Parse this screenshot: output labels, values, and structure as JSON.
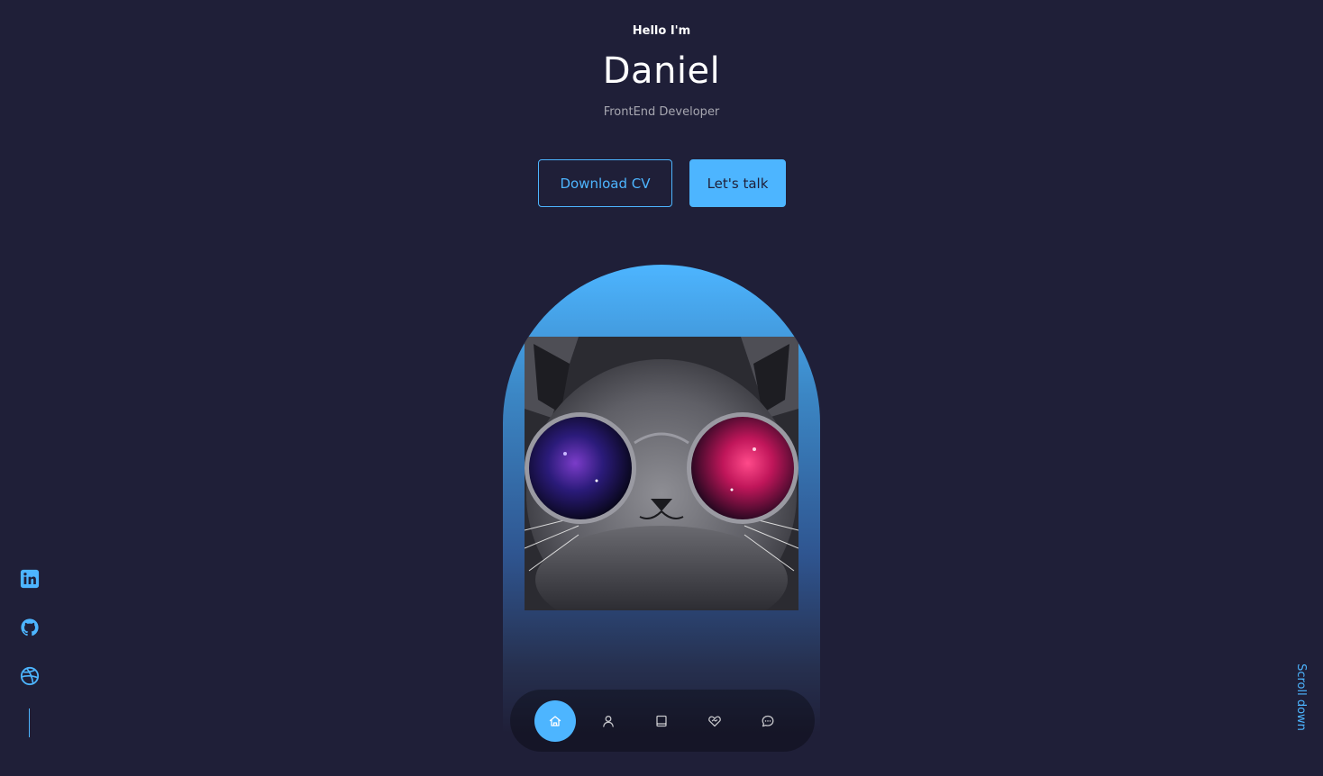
{
  "header": {
    "greeting": "Hello I'm",
    "name": "Daniel",
    "role": "FrontEnd Developer"
  },
  "actions": {
    "download_cv": "Download CV",
    "lets_talk": "Let's talk"
  },
  "socials": [
    {
      "icon": "linkedin-icon"
    },
    {
      "icon": "github-icon"
    },
    {
      "icon": "dribbble-icon"
    }
  ],
  "scroll": {
    "label": "Scroll down"
  },
  "nav": {
    "items": [
      {
        "icon": "home-icon",
        "active": true
      },
      {
        "icon": "user-icon",
        "active": false
      },
      {
        "icon": "book-icon",
        "active": false
      },
      {
        "icon": "services-icon",
        "active": false
      },
      {
        "icon": "message-icon",
        "active": false
      }
    ]
  },
  "colors": {
    "background": "#1f1f38",
    "accent": "#4db5ff",
    "text": "#ffffff",
    "muted_text": "rgba(255,255,255,0.6)"
  }
}
